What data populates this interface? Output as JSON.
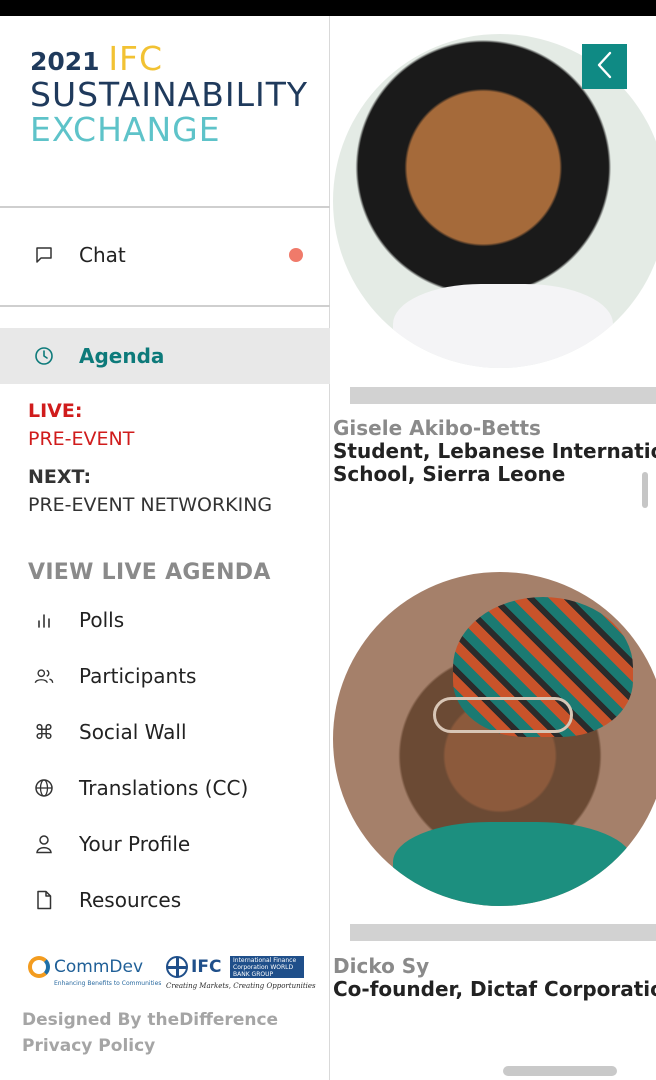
{
  "brand": {
    "year": "2021",
    "org": "IFC",
    "line2": "SUSTAINABILITY",
    "line3": "EXCHANGE"
  },
  "menu": {
    "chat": "Chat",
    "agenda": "Agenda",
    "polls": "Polls",
    "participants": "Participants",
    "social_wall": "Social Wall",
    "translations": "Translations (CC)",
    "profile": "Your Profile",
    "resources": "Resources"
  },
  "agenda": {
    "live_label": "LIVE:",
    "live_value": "PRE-EVENT",
    "next_label": "NEXT:",
    "next_value": "PRE-EVENT NETWORKING",
    "view_live": "VIEW LIVE AGENDA"
  },
  "footer": {
    "commdev_name": "CommDev",
    "commdev_tagline": "Enhancing Benefits to Communities",
    "ifc_name": "IFC",
    "ifc_box": "International Finance Corporation WORLD BANK GROUP",
    "ifc_tagline": "Creating Markets, Creating Opportunities",
    "designed_by": "Designed By theDifference",
    "privacy": "Privacy Policy"
  },
  "speakers": [
    {
      "name": "Gisele Akibo-Betts",
      "title_line1": "Student, Lebanese Internatio",
      "title_line2": "School, Sierra Leone"
    },
    {
      "name": "Dicko Sy",
      "title_line1": "Co-founder, Dictaf Corporatio"
    }
  ],
  "colors": {
    "accent": "#0f8a84",
    "live_red": "#d01c1c",
    "notification_dot": "#f07a6a",
    "logo_navy": "#1f3a5c",
    "logo_yellow": "#f2c233",
    "logo_teal": "#5ec3c9"
  }
}
